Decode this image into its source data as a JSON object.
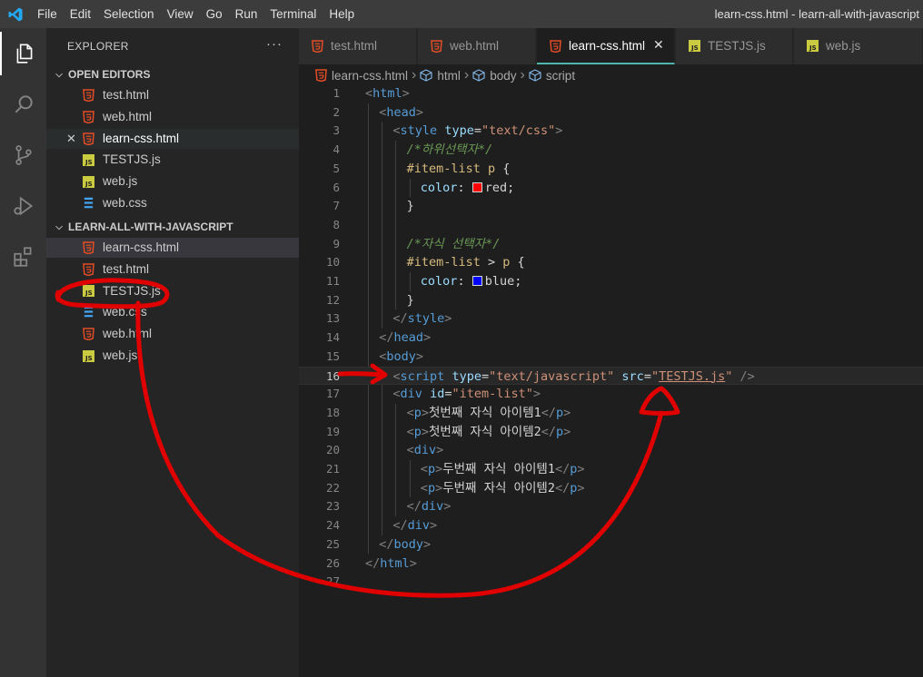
{
  "menu": [
    "File",
    "Edit",
    "Selection",
    "View",
    "Go",
    "Run",
    "Terminal",
    "Help"
  ],
  "window_title": "learn-css.html - learn-all-with-javascript",
  "activity_bar": [
    "explorer-icon",
    "search-icon",
    "source-control-icon",
    "run-debug-icon",
    "extensions-icon"
  ],
  "sidebar": {
    "title": "EXPLORER",
    "more": "···",
    "open_editors": {
      "title": "OPEN EDITORS",
      "files": [
        {
          "name": "test.html",
          "type": "html"
        },
        {
          "name": "web.html",
          "type": "html"
        },
        {
          "name": "learn-css.html",
          "type": "html",
          "active": true
        },
        {
          "name": "TESTJS.js",
          "type": "js"
        },
        {
          "name": "web.js",
          "type": "js"
        },
        {
          "name": "web.css",
          "type": "css"
        }
      ]
    },
    "workspace": {
      "title": "LEARN-ALL-WITH-JAVASCRIPT",
      "files": [
        {
          "name": "learn-css.html",
          "type": "html"
        },
        {
          "name": "test.html",
          "type": "html"
        },
        {
          "name": "TESTJS.js",
          "type": "js"
        },
        {
          "name": "web.css",
          "type": "css"
        },
        {
          "name": "web.html",
          "type": "html"
        },
        {
          "name": "web.js",
          "type": "js"
        }
      ]
    }
  },
  "tabs": [
    {
      "name": "test.html",
      "type": "html"
    },
    {
      "name": "web.html",
      "type": "html"
    },
    {
      "name": "learn-css.html",
      "type": "html",
      "active": true
    },
    {
      "name": "TESTJS.js",
      "type": "js"
    },
    {
      "name": "web.js",
      "type": "js"
    }
  ],
  "breadcrumb": [
    "learn-css.html",
    "html",
    "body",
    "script"
  ],
  "code": {
    "current_line": 16,
    "lines": [
      {
        "n": "1",
        "indent": 0,
        "tokens": [
          [
            "br",
            "<"
          ],
          [
            "tag",
            "html"
          ],
          [
            "br",
            ">"
          ]
        ]
      },
      {
        "n": "2",
        "indent": 1,
        "tokens": [
          [
            "br",
            "<"
          ],
          [
            "tag",
            "head"
          ],
          [
            "br",
            ">"
          ]
        ]
      },
      {
        "n": "3",
        "indent": 2,
        "tokens": [
          [
            "br",
            "<"
          ],
          [
            "tag",
            "style"
          ],
          [
            "text",
            " "
          ],
          [
            "attr",
            "type"
          ],
          [
            "punc",
            "="
          ],
          [
            "str",
            "\"text/css\""
          ],
          [
            "br",
            ">"
          ]
        ]
      },
      {
        "n": "4",
        "indent": 3,
        "tokens": [
          [
            "comment",
            "/*하위선택자*/"
          ]
        ]
      },
      {
        "n": "5",
        "indent": 3,
        "tokens": [
          [
            "sel",
            "#item-list"
          ],
          [
            "text",
            " "
          ],
          [
            "sel",
            "p"
          ],
          [
            "punc",
            " {"
          ]
        ]
      },
      {
        "n": "6",
        "indent": 4,
        "tokens": [
          [
            "prop",
            "color"
          ],
          [
            "punc",
            ": "
          ],
          [
            "swatch",
            "#ff0000"
          ],
          [
            "val",
            "red"
          ],
          [
            "punc",
            ";"
          ]
        ]
      },
      {
        "n": "7",
        "indent": 3,
        "tokens": [
          [
            "punc",
            "}"
          ]
        ]
      },
      {
        "n": "8",
        "indent": 3,
        "tokens": []
      },
      {
        "n": "9",
        "indent": 3,
        "tokens": [
          [
            "comment",
            "/*자식 선택자*/"
          ]
        ]
      },
      {
        "n": "10",
        "indent": 3,
        "tokens": [
          [
            "sel",
            "#item-list"
          ],
          [
            "text",
            " > "
          ],
          [
            "sel",
            "p"
          ],
          [
            "punc",
            " {"
          ]
        ]
      },
      {
        "n": "11",
        "indent": 4,
        "tokens": [
          [
            "prop",
            "color"
          ],
          [
            "punc",
            ": "
          ],
          [
            "swatch",
            "#0000ff"
          ],
          [
            "val",
            "blue"
          ],
          [
            "punc",
            ";"
          ]
        ]
      },
      {
        "n": "12",
        "indent": 3,
        "tokens": [
          [
            "punc",
            "}"
          ]
        ]
      },
      {
        "n": "13",
        "indent": 2,
        "tokens": [
          [
            "br",
            "</"
          ],
          [
            "tag",
            "style"
          ],
          [
            "br",
            ">"
          ]
        ]
      },
      {
        "n": "14",
        "indent": 1,
        "tokens": [
          [
            "br",
            "</"
          ],
          [
            "tag",
            "head"
          ],
          [
            "br",
            ">"
          ]
        ]
      },
      {
        "n": "15",
        "indent": 1,
        "tokens": [
          [
            "br",
            "<"
          ],
          [
            "tag",
            "body"
          ],
          [
            "br",
            ">"
          ]
        ]
      },
      {
        "n": "16",
        "indent": 2,
        "tokens": [
          [
            "br",
            "<"
          ],
          [
            "tag",
            "script"
          ],
          [
            "text",
            " "
          ],
          [
            "attr",
            "type"
          ],
          [
            "punc",
            "="
          ],
          [
            "str",
            "\"text/javascript\""
          ],
          [
            "text",
            " "
          ],
          [
            "attr",
            "src"
          ],
          [
            "punc",
            "="
          ],
          [
            "str",
            "\""
          ],
          [
            "strU",
            "TESTJS.js"
          ],
          [
            "str",
            "\""
          ],
          [
            "text",
            " "
          ],
          [
            "br",
            "/>"
          ]
        ]
      },
      {
        "n": "17",
        "indent": 2,
        "tokens": [
          [
            "br",
            "<"
          ],
          [
            "tag",
            "div"
          ],
          [
            "text",
            " "
          ],
          [
            "attr",
            "id"
          ],
          [
            "punc",
            "="
          ],
          [
            "str",
            "\"item-list\""
          ],
          [
            "br",
            ">"
          ]
        ]
      },
      {
        "n": "18",
        "indent": 3,
        "tokens": [
          [
            "br",
            "<"
          ],
          [
            "tag",
            "p"
          ],
          [
            "br",
            ">"
          ],
          [
            "text",
            "첫번째 자식 아이템1"
          ],
          [
            "br",
            "</"
          ],
          [
            "tag",
            "p"
          ],
          [
            "br",
            ">"
          ]
        ]
      },
      {
        "n": "19",
        "indent": 3,
        "tokens": [
          [
            "br",
            "<"
          ],
          [
            "tag",
            "p"
          ],
          [
            "br",
            ">"
          ],
          [
            "text",
            "첫번째 자식 아이템2"
          ],
          [
            "br",
            "</"
          ],
          [
            "tag",
            "p"
          ],
          [
            "br",
            ">"
          ]
        ]
      },
      {
        "n": "20",
        "indent": 3,
        "tokens": [
          [
            "br",
            "<"
          ],
          [
            "tag",
            "div"
          ],
          [
            "br",
            ">"
          ]
        ]
      },
      {
        "n": "21",
        "indent": 4,
        "tokens": [
          [
            "br",
            "<"
          ],
          [
            "tag",
            "p"
          ],
          [
            "br",
            ">"
          ],
          [
            "text",
            "두번째 자식 아이템1"
          ],
          [
            "br",
            "</"
          ],
          [
            "tag",
            "p"
          ],
          [
            "br",
            ">"
          ]
        ]
      },
      {
        "n": "22",
        "indent": 4,
        "tokens": [
          [
            "br",
            "<"
          ],
          [
            "tag",
            "p"
          ],
          [
            "br",
            ">"
          ],
          [
            "text",
            "두번째 자식 아이템2"
          ],
          [
            "br",
            "</"
          ],
          [
            "tag",
            "p"
          ],
          [
            "br",
            ">"
          ]
        ]
      },
      {
        "n": "23",
        "indent": 3,
        "tokens": [
          [
            "br",
            "</"
          ],
          [
            "tag",
            "div"
          ],
          [
            "br",
            ">"
          ]
        ]
      },
      {
        "n": "24",
        "indent": 2,
        "tokens": [
          [
            "br",
            "</"
          ],
          [
            "tag",
            "div"
          ],
          [
            "br",
            ">"
          ]
        ]
      },
      {
        "n": "25",
        "indent": 1,
        "tokens": [
          [
            "br",
            "</"
          ],
          [
            "tag",
            "body"
          ],
          [
            "br",
            ">"
          ]
        ]
      },
      {
        "n": "26",
        "indent": 0,
        "tokens": [
          [
            "br",
            "</"
          ],
          [
            "tag",
            "html"
          ],
          [
            "br",
            ">"
          ]
        ]
      },
      {
        "n": "27",
        "indent": 0,
        "tokens": []
      }
    ]
  },
  "colors": {
    "accent_tab": "#4db6ac",
    "html_icon": "#e44d26",
    "js_icon": "#cbcb41",
    "css_icon": "#42a5f5",
    "annotation": "#e10000"
  }
}
